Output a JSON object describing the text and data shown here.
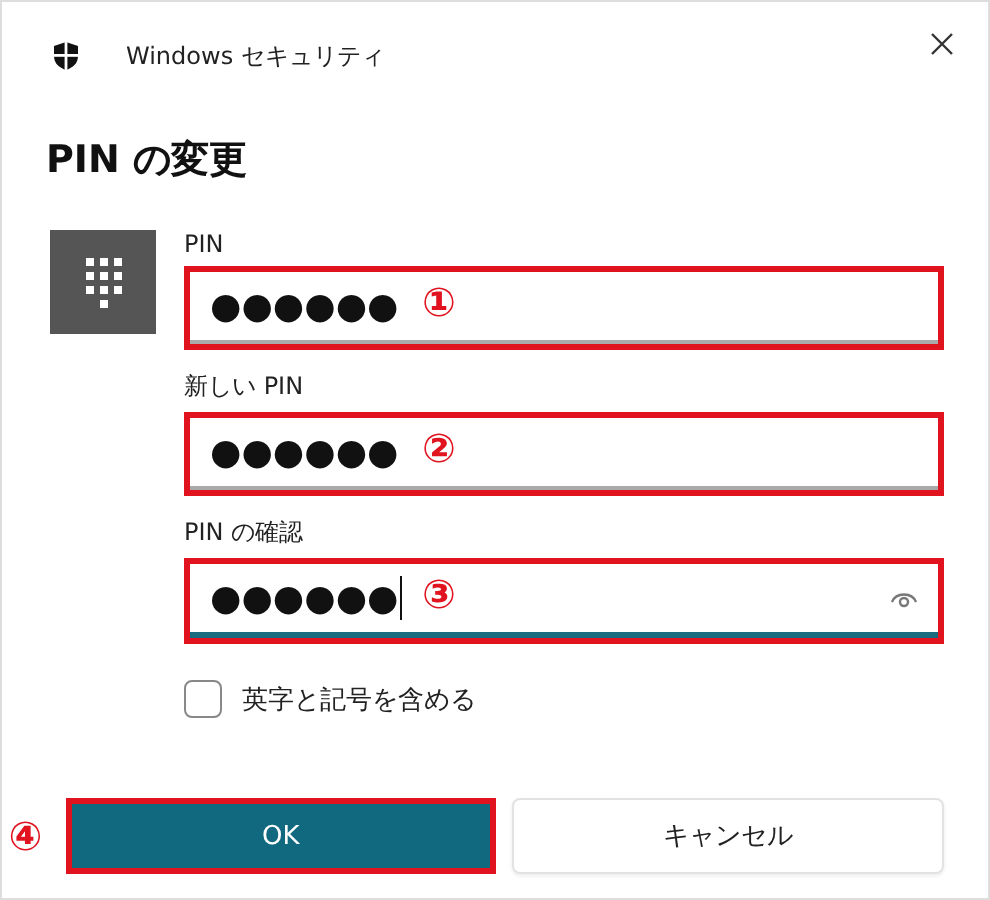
{
  "window": {
    "title": "Windows セキュリティ"
  },
  "heading": "PIN の変更",
  "fields": [
    {
      "label": "PIN",
      "value": "●●●●●●",
      "focused": false,
      "annotation": "①"
    },
    {
      "label": "新しい PIN",
      "value": "●●●●●●",
      "focused": false,
      "annotation": "②"
    },
    {
      "label": "PIN の確認",
      "value": "●●●●●●",
      "focused": true,
      "annotation": "③"
    }
  ],
  "checkbox": {
    "label": "英字と記号を含める",
    "checked": false
  },
  "buttons": [
    {
      "label": "OK",
      "kind": "primary",
      "annotation": "④"
    },
    {
      "label": "キャンセル",
      "kind": "secondary"
    }
  ]
}
